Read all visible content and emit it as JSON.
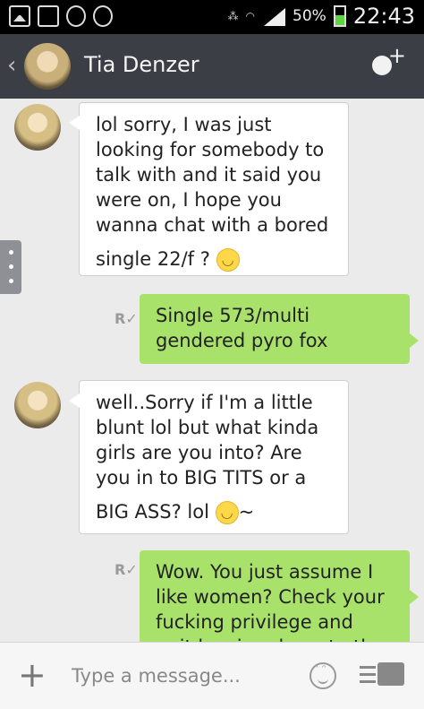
{
  "status_bar": {
    "battery_pct": "50%",
    "time": "22:43",
    "battery_level": 0.5
  },
  "header": {
    "back_glyph": "‹",
    "contact_name": "Tia Denzer",
    "add_icon": "add-user-icon"
  },
  "messages": [
    {
      "direction": "in",
      "lines": [
        "lol sorry, I was just",
        "looking for somebody to",
        "talk with and it said you",
        "were on, I hope you",
        "wanna chat with a bored"
      ],
      "last_line": "single 22/f ?",
      "emoji": "😊"
    },
    {
      "direction": "out",
      "read_mark": "R✓",
      "lines": [
        "Single 573/multi",
        "gendered pyro fox"
      ]
    },
    {
      "direction": "in",
      "lines": [
        "well..Sorry if I'm a little",
        "blunt lol but what kinda",
        "girls are you into? Are",
        "you in to BIG TITS or a"
      ],
      "last_line": "BIG ASS? lol",
      "emoji": "😏",
      "trail": "~"
    },
    {
      "direction": "out",
      "read_mark": "R✓",
      "lines": [
        "Wow. You just assume I",
        "like women? Check your",
        "fucking privilege and",
        "quit bowing down to the"
      ]
    }
  ],
  "input": {
    "placeholder": "Type a message...",
    "add_glyph": "+",
    "emoji_icon": "emoji-icon",
    "more_icon": "more-options-icon"
  },
  "colors": {
    "header": "#3b3e45",
    "background": "#ebebeb",
    "outgoing_bubble": "#a9e26b",
    "incoming_bubble": "#ffffff"
  }
}
